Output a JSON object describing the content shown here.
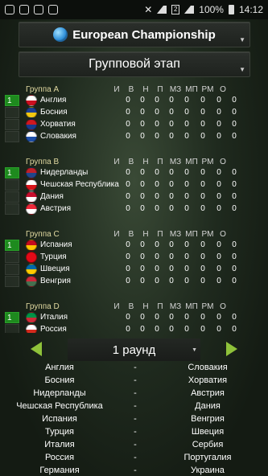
{
  "status": {
    "battery": "100%",
    "time": "14:12",
    "sim": "2"
  },
  "championship": {
    "label": "European Championship"
  },
  "stage": {
    "label": "Групповой этап"
  },
  "columns": [
    "И",
    "В",
    "Н",
    "П",
    "МЗ",
    "МП",
    "РМ",
    "О"
  ],
  "groups": [
    {
      "name": "Группа A",
      "rows": [
        {
          "pos": "1",
          "team": "Англия",
          "flag": [
            "#ffffff",
            "#cc1020"
          ],
          "stats": [
            "0",
            "0",
            "0",
            "0",
            "0",
            "0",
            "0",
            "0"
          ]
        },
        {
          "pos": "",
          "team": "Босния",
          "flag": [
            "#1c3f94",
            "#f2c811"
          ],
          "stats": [
            "0",
            "0",
            "0",
            "0",
            "0",
            "0",
            "0",
            "0"
          ]
        },
        {
          "pos": "",
          "team": "Хорватия",
          "flag": [
            "#d01820",
            "#1a3a8c"
          ],
          "stats": [
            "0",
            "0",
            "0",
            "0",
            "0",
            "0",
            "0",
            "0"
          ]
        },
        {
          "pos": "",
          "team": "Словакия",
          "flag": [
            "#ffffff",
            "#1d4fa8"
          ],
          "stats": [
            "0",
            "0",
            "0",
            "0",
            "0",
            "0",
            "0",
            "0"
          ]
        }
      ]
    },
    {
      "name": "Группа B",
      "rows": [
        {
          "pos": "1",
          "team": "Нидерланды",
          "flag": [
            "#c0202a",
            "#21468b"
          ],
          "stats": [
            "0",
            "0",
            "0",
            "0",
            "0",
            "0",
            "0",
            "0"
          ]
        },
        {
          "pos": "",
          "team": "Чешская Республика",
          "flag": [
            "#ffffff",
            "#d7141a"
          ],
          "stats": [
            "0",
            "0",
            "0",
            "0",
            "0",
            "0",
            "0",
            "0"
          ]
        },
        {
          "pos": "",
          "team": "Дания",
          "flag": [
            "#c8102e",
            "#ffffff"
          ],
          "stats": [
            "0",
            "0",
            "0",
            "0",
            "0",
            "0",
            "0",
            "0"
          ]
        },
        {
          "pos": "",
          "team": "Австрия",
          "flag": [
            "#ed2939",
            "#ffffff"
          ],
          "stats": [
            "0",
            "0",
            "0",
            "0",
            "0",
            "0",
            "0",
            "0"
          ]
        }
      ]
    },
    {
      "name": "Группа C",
      "rows": [
        {
          "pos": "1",
          "team": "Испания",
          "flag": [
            "#c60b1e",
            "#ffc400"
          ],
          "stats": [
            "0",
            "0",
            "0",
            "0",
            "0",
            "0",
            "0",
            "0"
          ]
        },
        {
          "pos": "",
          "team": "Турция",
          "flag": [
            "#e30a17",
            "#e30a17"
          ],
          "stats": [
            "0",
            "0",
            "0",
            "0",
            "0",
            "0",
            "0",
            "0"
          ]
        },
        {
          "pos": "",
          "team": "Швеция",
          "flag": [
            "#006aa7",
            "#fecc00"
          ],
          "stats": [
            "0",
            "0",
            "0",
            "0",
            "0",
            "0",
            "0",
            "0"
          ]
        },
        {
          "pos": "",
          "team": "Венгрия",
          "flag": [
            "#ce2939",
            "#477050"
          ],
          "stats": [
            "0",
            "0",
            "0",
            "0",
            "0",
            "0",
            "0",
            "0"
          ]
        }
      ]
    },
    {
      "name": "Группа D",
      "rows": [
        {
          "pos": "1",
          "team": "Италия",
          "flag": [
            "#009246",
            "#ce2b37"
          ],
          "stats": [
            "0",
            "0",
            "0",
            "0",
            "0",
            "0",
            "0",
            "0"
          ]
        },
        {
          "pos": "",
          "team": "Россия",
          "flag": [
            "#ffffff",
            "#d52b1e"
          ],
          "stats": [
            "0",
            "0",
            "0",
            "0",
            "0",
            "0",
            "0",
            "0"
          ]
        }
      ]
    }
  ],
  "round": {
    "label": "1 раунд"
  },
  "matches": [
    {
      "home": "Англия",
      "sep": "-",
      "away": "Словакия"
    },
    {
      "home": "Босния",
      "sep": "-",
      "away": "Хорватия"
    },
    {
      "home": "Нидерланды",
      "sep": "-",
      "away": "Австрия"
    },
    {
      "home": "Чешская Республика",
      "sep": "-",
      "away": "Дания"
    },
    {
      "home": "Испания",
      "sep": "-",
      "away": "Венгрия"
    },
    {
      "home": "Турция",
      "sep": "-",
      "away": "Швеция"
    },
    {
      "home": "Италия",
      "sep": "-",
      "away": "Сербия"
    },
    {
      "home": "Россия",
      "sep": "-",
      "away": "Португалия"
    },
    {
      "home": "Германия",
      "sep": "-",
      "away": "Украина"
    }
  ]
}
